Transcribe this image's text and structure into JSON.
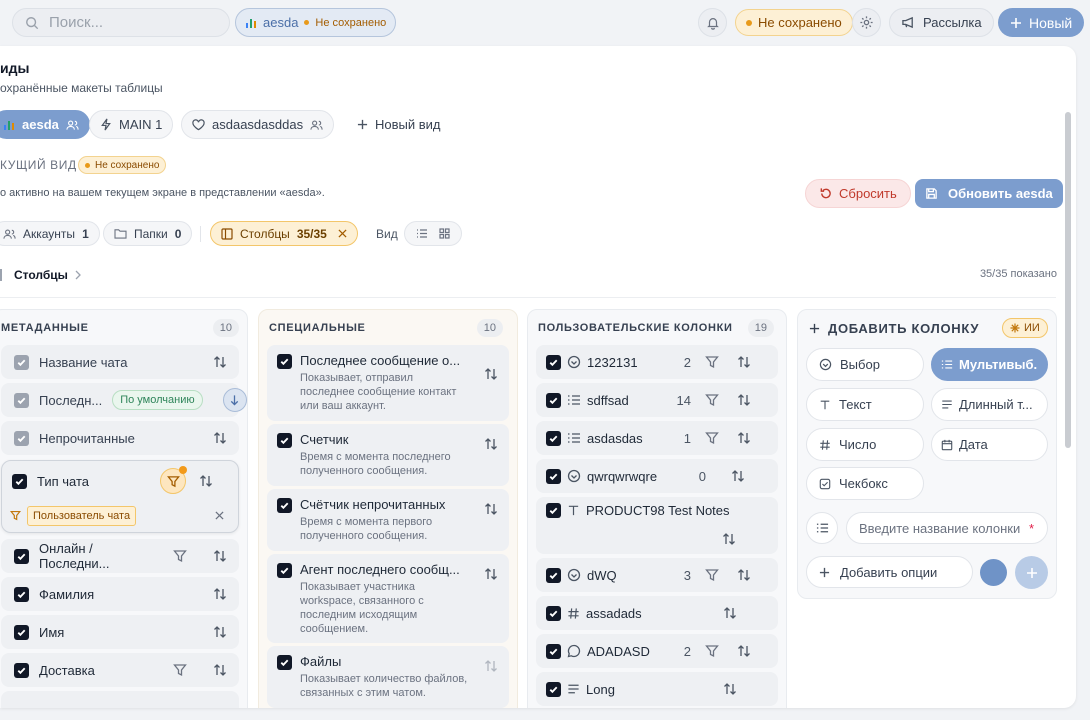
{
  "topbar": {
    "search_placeholder": "Поиск...",
    "view_chip_name": "aesda",
    "view_chip_status": "Не сохранено",
    "unsaved_badge": "Не сохранено",
    "mailing_label": "Рассылка",
    "new_label": "Новый"
  },
  "panel": {
    "title": "иды",
    "subtitle": "охранённые макеты таблицы",
    "views": [
      {
        "label": "aesda"
      },
      {
        "label": "MAIN 1"
      },
      {
        "label": "asdaasdasddas"
      },
      {
        "label": "Новый вид"
      }
    ],
    "current_view_label": "КУЩИЙ ВИД",
    "current_view_status": "Не сохранено",
    "current_view_note": "о активно на вашем текущем экране в представлении «aesda».",
    "reset_label": "Сбросить",
    "update_label": "Обновить aesda",
    "filters": {
      "accounts_label": "Аккаунты",
      "accounts_count": "1",
      "folders_label": "Папки",
      "folders_count": "0",
      "columns_label": "Столбцы",
      "columns_count": "35/35",
      "view_label": "Вид"
    },
    "breadcrumb": "Столбцы",
    "shown_count": "35/35 показано"
  },
  "metadata": {
    "title": "МЕТАДАННЫЕ",
    "count": "10",
    "rows": [
      {
        "label": "Название чата"
      },
      {
        "label": "Последн...",
        "badge": "По умолчанию"
      },
      {
        "label": "Непрочитанные"
      },
      {
        "label": "Тип чата",
        "filter_value": "Пользователь чата"
      },
      {
        "label": "Онлайн / Последни..."
      },
      {
        "label": "Фамилия"
      },
      {
        "label": "Имя"
      },
      {
        "label": "Доставка"
      }
    ]
  },
  "special": {
    "title": "СПЕЦИАЛЬНЫЕ",
    "count": "10",
    "items": [
      {
        "label": "Последнее сообщение о...",
        "desc": [
          "Показывает, отправил",
          "последнее сообщение контакт",
          "или ваш аккаунт."
        ]
      },
      {
        "label": "Счетчик",
        "desc": [
          "Время с момента последнего",
          "полученного сообщения."
        ]
      },
      {
        "label": "Счётчик непрочитанных",
        "desc": [
          "Время с момента первого",
          "полученного сообщения."
        ]
      },
      {
        "label": "Агент последнего сообщ...",
        "desc": [
          "Показывает участника",
          "workspace, связанного с",
          "последним исходящим",
          "сообщением."
        ]
      },
      {
        "label": "Файлы",
        "desc": [
          "Показывает количество файлов,",
          "связанных с этим чатом."
        ]
      }
    ]
  },
  "custom": {
    "title": "ПОЛЬЗОВАТЕЛЬСКИЕ КОЛОНКИ",
    "count": "19",
    "rows": [
      {
        "icon": "select-icon",
        "label": "1232131",
        "num": "2"
      },
      {
        "icon": "list-icon",
        "label": "sdffsad",
        "num": "14"
      },
      {
        "icon": "list-icon",
        "label": "asdasdas",
        "num": "1"
      },
      {
        "icon": "select-icon",
        "label": "qwrqwrwqre",
        "num": "0"
      },
      {
        "icon": "text-icon",
        "label": "PRODUCT98 Test Notes"
      },
      {
        "icon": "select-icon",
        "label": "dWQ",
        "num": "3"
      },
      {
        "icon": "hash-icon",
        "label": "assadads"
      },
      {
        "icon": "chat-icon",
        "label": "ADADASD",
        "num": "2"
      },
      {
        "icon": "long-text-icon",
        "label": "Long"
      }
    ]
  },
  "add_column": {
    "title": "ДОБАВИТЬ КОЛОНКУ",
    "ai_badge": "ИИ",
    "types": [
      "Выбор",
      "Мультивыб...",
      "Текст",
      "Длинный т...",
      "Число",
      "Дата",
      "Чекбокс"
    ],
    "name_placeholder": "Введите название колонки",
    "add_options_label": "Добавить опции"
  },
  "colors": {
    "accent": "#6f93c7",
    "unsaved_bg": "#fdf0d5",
    "unsaved_text": "#a35c00",
    "reset_bg": "#fbe8e8",
    "reset_text": "#c0392b"
  }
}
